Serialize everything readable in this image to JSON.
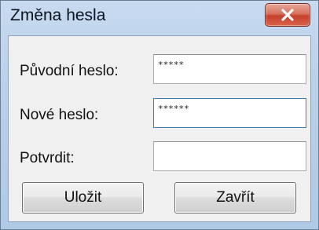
{
  "window": {
    "title": "Změna hesla"
  },
  "form": {
    "original_password_label": "Původní heslo:",
    "original_password_value": "*****",
    "new_password_label": "Nové heslo:",
    "new_password_value": "******",
    "confirm_label": "Potvrdit:",
    "confirm_value": ""
  },
  "buttons": {
    "save_label": "Uložit",
    "close_label": "Zavřít"
  },
  "icons": {
    "close": "close-icon"
  },
  "colors": {
    "titlebar": "#b9d0ea",
    "close_button": "#c6402b",
    "focus_border": "#3c7fb1"
  }
}
